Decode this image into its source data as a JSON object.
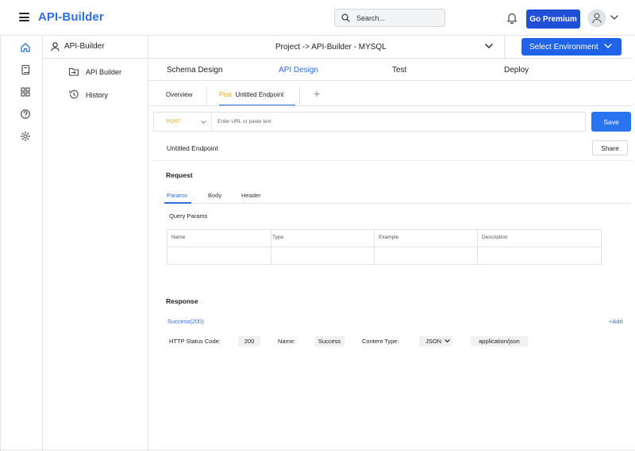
{
  "app": {
    "brand": "API-Builder"
  },
  "header": {
    "search_placeholder": "Search...",
    "premium_label": "Go Premium"
  },
  "sidebar": {
    "title": "API-Builder",
    "items": [
      {
        "label": "API Builder",
        "icon": "folder-import-icon"
      },
      {
        "label": "History",
        "icon": "history-icon"
      }
    ]
  },
  "rail": {
    "icons": [
      "home-icon",
      "book-icon",
      "grid-icon",
      "help-icon",
      "settings-icon"
    ]
  },
  "project": {
    "title": "Project -> API-Builder - MYSQL",
    "env_label": "Select Environment"
  },
  "main_tabs": [
    {
      "label": "Schema Design",
      "active": false
    },
    {
      "label": "API Design",
      "active": true
    },
    {
      "label": "Test",
      "active": false
    },
    {
      "label": "Deploy",
      "active": false
    }
  ],
  "sub_tabs": {
    "overview": "Overview",
    "endpoint_method": "Post",
    "endpoint_name": "Untitled Endpoint"
  },
  "request_bar": {
    "method": "POST",
    "url_placeholder": "Enter URL or paste text",
    "save_label": "Save"
  },
  "endpoint": {
    "name": "Untitled  Endpoint",
    "share_label": "Share"
  },
  "request": {
    "title": "Request",
    "tabs": [
      {
        "label": "Params",
        "active": true
      },
      {
        "label": "Body",
        "active": false
      },
      {
        "label": "Header",
        "active": false
      }
    ],
    "query_params_label": "Query Params",
    "columns": [
      "Name",
      "Type",
      "Example",
      "Description"
    ]
  },
  "response": {
    "title": "Response",
    "success_label": "Success(200)",
    "add_label": "+Add",
    "status_code_label": "HTTP Status Code:",
    "status_code": "200",
    "name_label": "Name:",
    "name_value": "Success",
    "content_type_label": "Content Type:",
    "content_type": "JSON",
    "mime": "application/json"
  },
  "colors": {
    "brand": "#2f6fde",
    "primary_button": "#1f63e8",
    "method_post": "#f29b18"
  }
}
